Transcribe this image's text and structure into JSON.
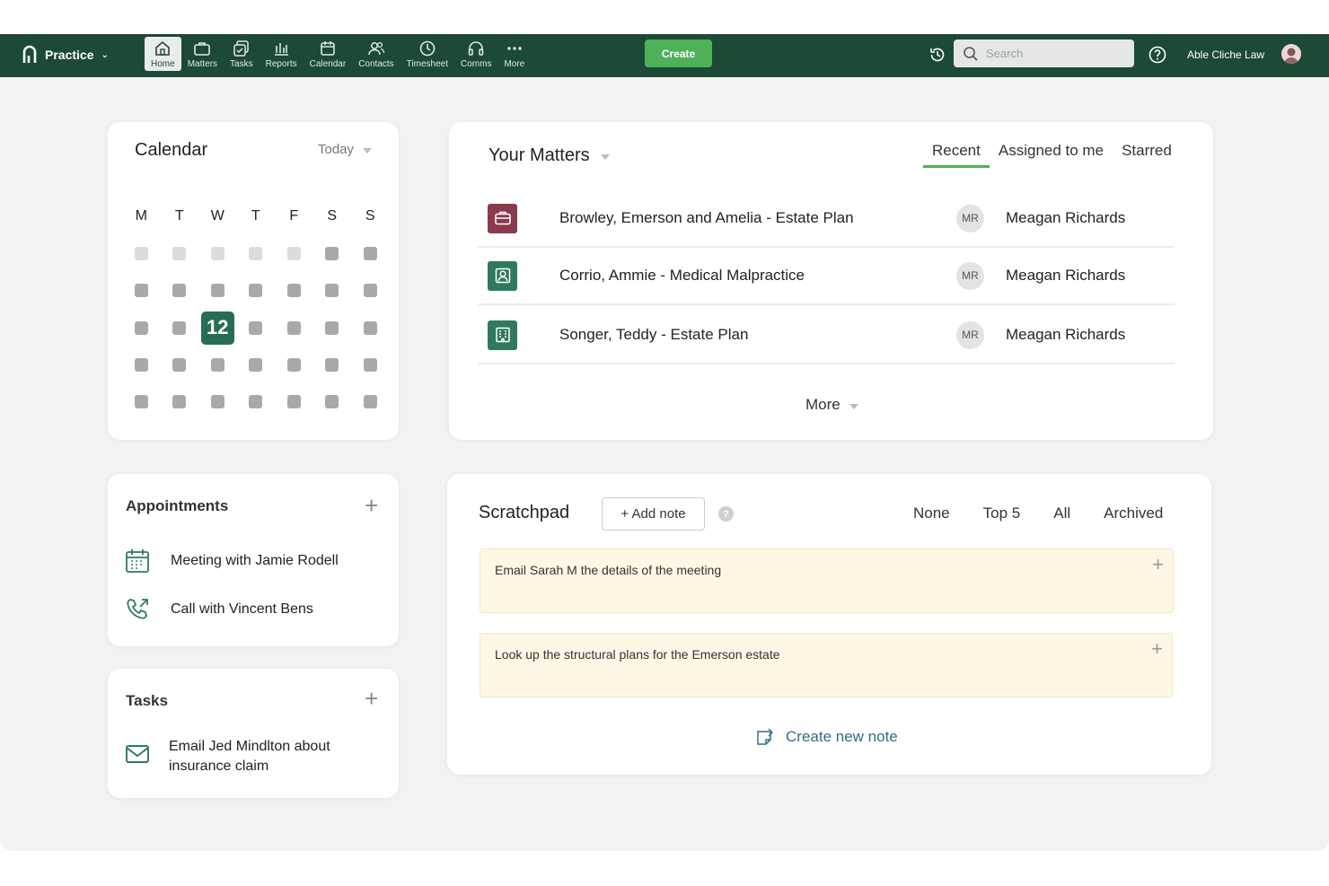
{
  "topbar": {
    "brand": "Practice",
    "nav": [
      {
        "label": "Home",
        "icon": "home-icon"
      },
      {
        "label": "Matters",
        "icon": "briefcase-icon"
      },
      {
        "label": "Tasks",
        "icon": "tasks-icon"
      },
      {
        "label": "Reports",
        "icon": "reports-icon"
      },
      {
        "label": "Calendar",
        "icon": "calendar-icon"
      },
      {
        "label": "Contacts",
        "icon": "contacts-icon"
      },
      {
        "label": "Timesheet",
        "icon": "clock-icon"
      },
      {
        "label": "Comms",
        "icon": "headset-icon"
      },
      {
        "label": "More",
        "icon": "more-icon"
      }
    ],
    "active_nav": "Home",
    "create_label": "Create",
    "search_placeholder": "Search",
    "org_name": "Able Cliche Law"
  },
  "calendar": {
    "title": "Calendar",
    "range": "Today",
    "weekdays": [
      "M",
      "T",
      "W",
      "T",
      "F",
      "S",
      "S"
    ],
    "today": "12"
  },
  "matters": {
    "title": "Your Matters",
    "tabs": [
      "Recent",
      "Assigned to me",
      "Starred"
    ],
    "active_tab": "Recent",
    "rows": [
      {
        "name": "Browley, Emerson and Amelia - Estate Plan",
        "initials": "MR",
        "person": "Meagan Richards",
        "icon": "briefcase-icon",
        "color": "#8a3a4c"
      },
      {
        "name": "Corrio, Ammie - Medical Malpractice",
        "initials": "MR",
        "person": "Meagan Richards",
        "icon": "person-badge-icon",
        "color": "#2f7a5c"
      },
      {
        "name": "Songer, Teddy - Estate Plan",
        "initials": "MR",
        "person": "Meagan Richards",
        "icon": "building-icon",
        "color": "#2f7a5c"
      }
    ],
    "more_label": "More"
  },
  "appointments": {
    "title": "Appointments",
    "items": [
      {
        "label": "Meeting with Jamie Rodell",
        "icon": "calendar-icon"
      },
      {
        "label": "Call with Vincent Bens",
        "icon": "phone-outgoing-icon"
      }
    ]
  },
  "tasks": {
    "title": "Tasks",
    "items": [
      {
        "label_line1": "Email Jed Mindlton about",
        "label_line2": "insurance claim",
        "icon": "mail-icon"
      }
    ]
  },
  "scratchpad": {
    "title": "Scratchpad",
    "add_note_label": "+ Add note",
    "help_symbol": "?",
    "filters": [
      "None",
      "Top 5",
      "All",
      "Archived"
    ],
    "notes": [
      "Email Sarah M the details of the meeting",
      "Look up the structural plans for the Emerson estate"
    ],
    "create_label": "Create new note"
  },
  "colors": {
    "nav_bg": "#1c4a36",
    "accent_green": "#4fb05a",
    "today_bg": "#286d52",
    "note_bg": "#fdf7e4",
    "link_blue": "#2f6f86"
  }
}
